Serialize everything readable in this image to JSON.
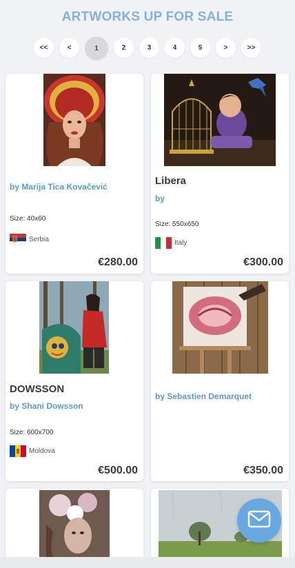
{
  "page": {
    "title": "ARTWORKS UP FOR SALE"
  },
  "pagination": {
    "items": [
      "<<",
      "<",
      "1",
      "2",
      "3",
      "4",
      "5",
      ">",
      ">>"
    ],
    "current": "1"
  },
  "artworks": [
    {
      "title": "",
      "artist": "by Marija Tica Kovačević",
      "size": "Size: 40x60",
      "country": "Serbia",
      "price": "€280.00"
    },
    {
      "title": "Libera",
      "artist": "by",
      "size": "Size: 550x650",
      "country": "Italy",
      "price": "€300.00"
    },
    {
      "title": "DOWSSON",
      "artist": "by Shani Dowsson",
      "size": "Size: 600x700",
      "country": "Moldova",
      "price": "€500.00"
    },
    {
      "title": "",
      "artist": "by Sebastien Demarquet",
      "size": "",
      "country": "",
      "price": "€350.00"
    }
  ],
  "colors": {
    "accent": "#86b1d9",
    "link": "#5e98cf",
    "fab": "#67a8e0"
  }
}
